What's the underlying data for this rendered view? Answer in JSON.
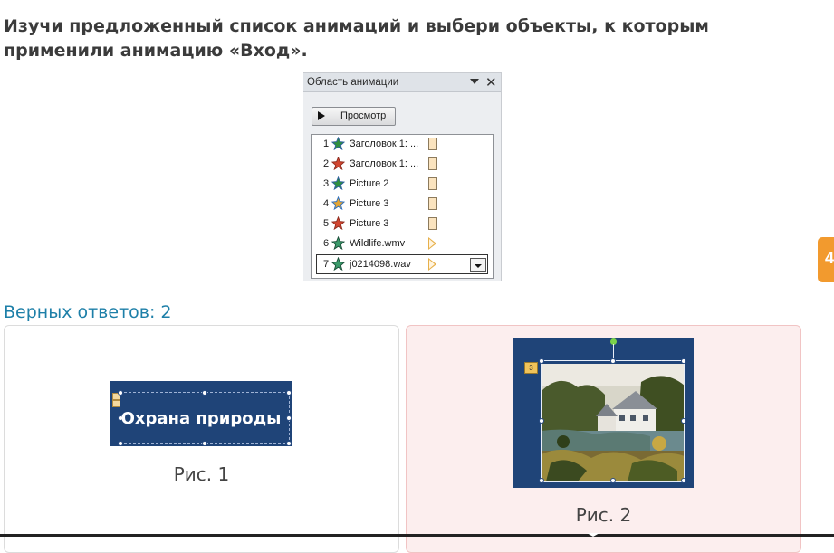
{
  "question": "Изучи предложенный список анимаций и выбери объекты, к которым применили анимацию «Вход».",
  "pane": {
    "title": "Область анимации",
    "preview_label": "Просмотр",
    "items": [
      {
        "num": "1",
        "name": "Заголовок 1: ...",
        "effect": "entrance",
        "timing": "box"
      },
      {
        "num": "2",
        "name": "Заголовок 1: ...",
        "effect": "exit",
        "timing": "box"
      },
      {
        "num": "3",
        "name": "Picture 2",
        "effect": "entrance",
        "timing": "box"
      },
      {
        "num": "4",
        "name": "Picture 3",
        "effect": "emphasis",
        "timing": "box"
      },
      {
        "num": "5",
        "name": "Picture 3",
        "effect": "exit",
        "timing": "box"
      },
      {
        "num": "6",
        "name": "Wildlife.wmv",
        "effect": "media",
        "timing": "triangle"
      },
      {
        "num": "7",
        "name": "j0214098.wav",
        "effect": "media",
        "timing": "triangle",
        "selected": true
      }
    ]
  },
  "answers_label": "Верных ответов: 2",
  "cards": [
    {
      "slide_text": "Охрана природы",
      "caption": "Рис. 1",
      "selected": false
    },
    {
      "badge": "3",
      "caption": "Рис. 2",
      "selected": true
    }
  ],
  "side_tab": "4",
  "colors": {
    "slide_blue": "#1f4478",
    "accent_blue": "#1d7fa8",
    "selected_card": "#fceeee",
    "side_tab": "#f29a2e"
  }
}
